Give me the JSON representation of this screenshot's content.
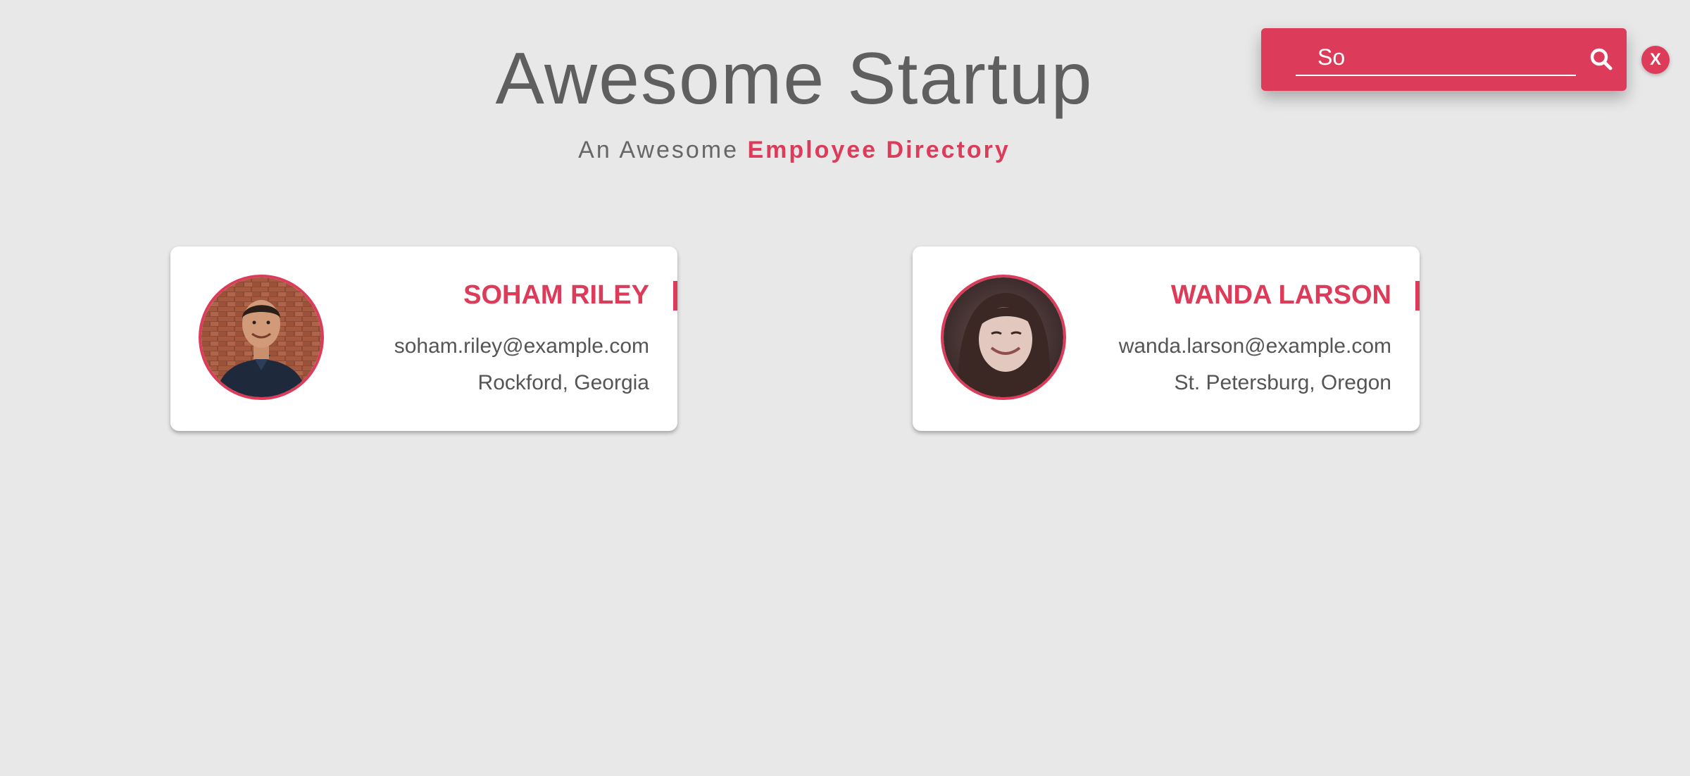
{
  "header": {
    "title": "Awesome Startup",
    "subtitle_prefix": "An Awesome ",
    "subtitle_accent": "Employee Directory"
  },
  "search": {
    "value": "So",
    "close_label": "X",
    "icon": "search-icon"
  },
  "colors": {
    "accent": "#dc3b5a",
    "background": "#e8e8e8",
    "card": "#ffffff",
    "text": "#555555"
  },
  "employees": [
    {
      "name": "SOHAM RILEY",
      "email": "soham.riley@example.com",
      "location": "Rockford, Georgia"
    },
    {
      "name": "WANDA LARSON",
      "email": "wanda.larson@example.com",
      "location": "St. Petersburg, Oregon"
    }
  ]
}
